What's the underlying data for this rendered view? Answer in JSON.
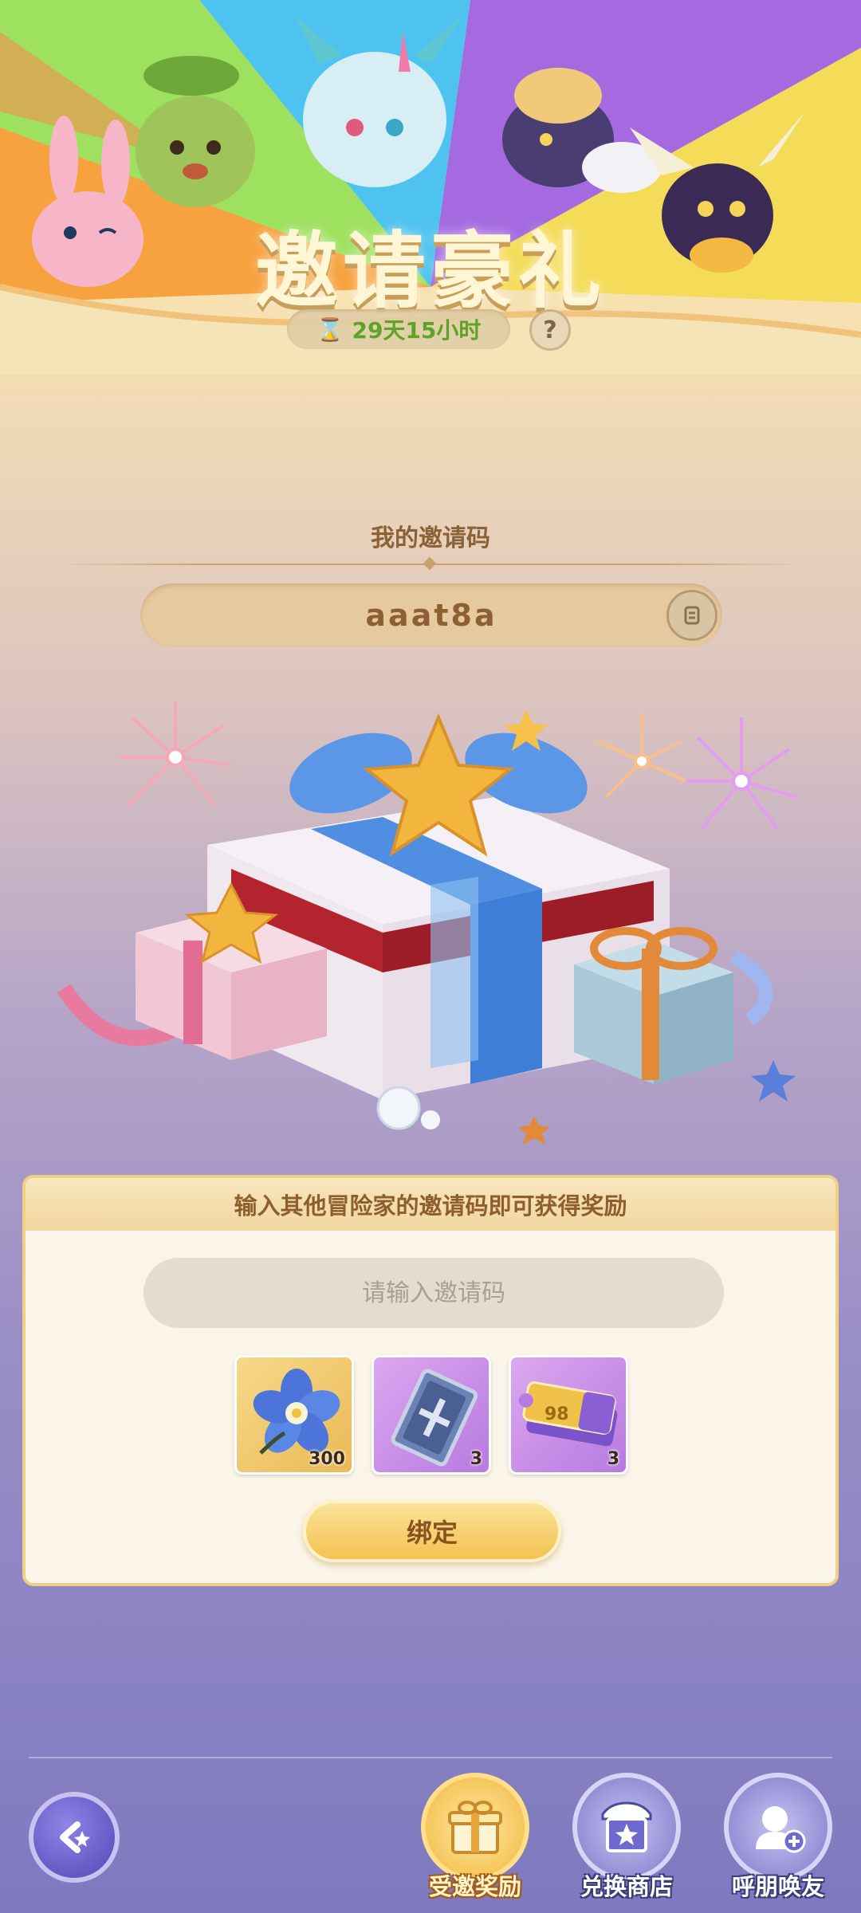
{
  "banner": {
    "title": "邀请豪礼",
    "countdown": "29天15小时",
    "help_label": "?"
  },
  "invite_code": {
    "heading": "我的邀请码",
    "value": "aaat8a"
  },
  "bind_panel": {
    "heading": "输入其他冒险家的邀请码即可获得奖励",
    "input_placeholder": "请输入邀请码",
    "rewards": [
      {
        "icon": "blue-flower-icon",
        "count": "300"
      },
      {
        "icon": "card-icon",
        "count": "3"
      },
      {
        "icon": "ticket-icon",
        "count": "3",
        "badge": "98"
      }
    ],
    "bind_label": "绑定"
  },
  "bottom_nav": {
    "items": [
      {
        "label": "受邀奖励",
        "icon": "gift-icon",
        "active": true
      },
      {
        "label": "兑换商店",
        "icon": "shop-icon",
        "active": false
      },
      {
        "label": "呼朋唤友",
        "icon": "add-friend-icon",
        "active": false
      }
    ]
  },
  "colors": {
    "accent_gold": "#f3c250",
    "brand_brown": "#8a6238",
    "timer_green": "#5da329",
    "nav_purple": "#5347b5"
  }
}
